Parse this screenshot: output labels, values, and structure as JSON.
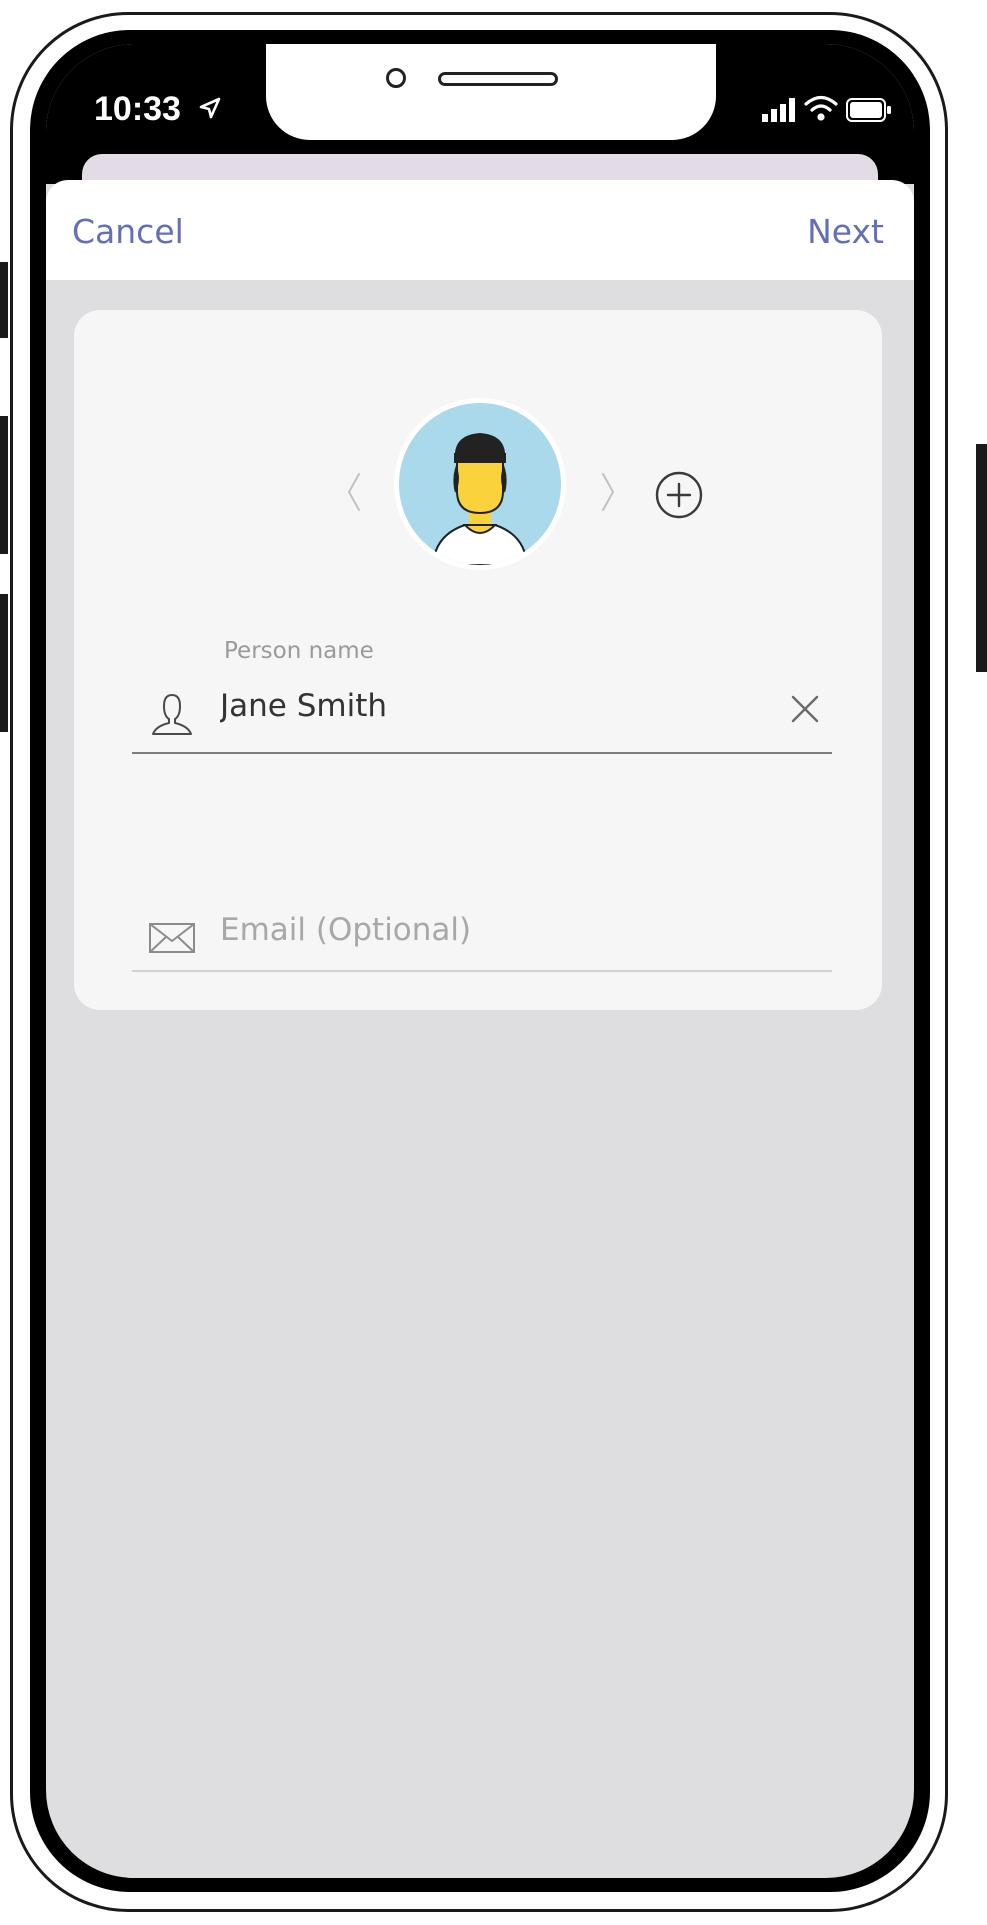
{
  "status_bar": {
    "time": "10:33",
    "icons": [
      "location-icon",
      "signal-icon",
      "wifi-icon",
      "battery-icon"
    ]
  },
  "nav": {
    "cancel_label": "Cancel",
    "next_label": "Next"
  },
  "avatar": {
    "icons": [
      "chevron-left-icon",
      "chevron-right-icon",
      "add-circle-icon"
    ]
  },
  "form": {
    "name_label": "Person name",
    "name_value": "Jane Smith",
    "name_icon": "person-icon",
    "clear_icon": "close-icon",
    "email_value": "",
    "email_placeholder": "Email (Optional)",
    "email_icon": "mail-icon"
  },
  "colors": {
    "accent": "#6370b8",
    "screen_background": "#dedde0",
    "card_background": "#f6f6f7",
    "avatar_background": "#a9d9ea",
    "avatar_face": "#f9d23c"
  }
}
